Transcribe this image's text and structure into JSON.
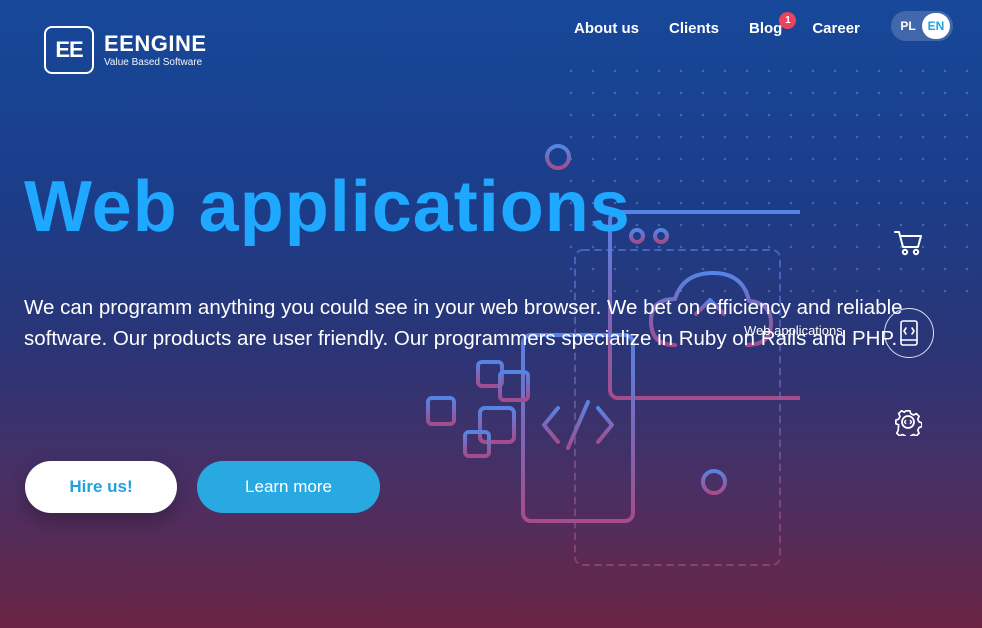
{
  "brand": {
    "logo_mark": "EE",
    "name": "EENGINE",
    "tagline": "Value Based Software"
  },
  "nav": {
    "items": [
      {
        "label": "About us"
      },
      {
        "label": "Clients"
      },
      {
        "label": "Blog",
        "badge": "1"
      },
      {
        "label": "Career"
      }
    ]
  },
  "language": {
    "options": [
      "PL",
      "EN"
    ],
    "selected": "EN"
  },
  "hero": {
    "title": "Web applications",
    "description": "We can programm anything you could see in your web browser. We bet on efficiency and reliable software. Our products are user friendly. Our programmers specialize in Ruby on Rails and PHP.",
    "primary_button": "Hire us!",
    "secondary_button": "Learn more"
  },
  "side_menu": {
    "active_label": "Web applications",
    "icons": [
      "cart-icon",
      "mobile-code-icon",
      "gear-code-icon"
    ]
  },
  "colors": {
    "accent": "#1fa8ff",
    "button_blue": "#29a9e1",
    "badge_red": "#e8435f"
  }
}
